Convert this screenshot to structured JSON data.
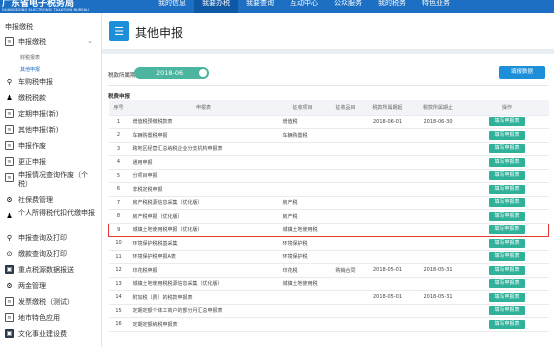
{
  "header": {
    "brand_zh": "广东省电子税务局",
    "brand_en": "GUANGDONG ELECTRONIC TAXATION BUREAU",
    "nav": [
      "我的信息",
      "我要办税",
      "我要查询",
      "互动中心",
      "公众服务",
      "我的税务",
      "特色业务"
    ]
  },
  "sidebar": {
    "title": "申报缴税",
    "items": [
      {
        "icon": "doc",
        "label": "申报缴税",
        "expanded": true
      },
      {
        "label": "财税报表"
      },
      {
        "label": "其他申报",
        "active": true
      },
      {
        "icon": "⚲",
        "label": "车购税申报"
      },
      {
        "icon": "♟",
        "label": "缴税税款"
      },
      {
        "icon": "doc",
        "label": "定期申报(新)"
      },
      {
        "icon": "doc",
        "label": "其他申报(新)"
      },
      {
        "icon": "doc",
        "label": "申报作废"
      },
      {
        "icon": "doc",
        "label": "更正申报"
      },
      {
        "icon": "doc",
        "label": "申报情况查询作废（个税）"
      },
      {
        "icon": "⚙",
        "label": "社保费管理"
      },
      {
        "icon": "♟",
        "label": "个人所得税代扣代缴申报"
      },
      {
        "icon": "⚲",
        "label": "申报查询及打印"
      },
      {
        "icon": "⊙",
        "label": "缴款查询及打印"
      },
      {
        "icon": "dark",
        "label": "重点税源数据报送"
      },
      {
        "icon": "⚙",
        "label": "两金管理"
      },
      {
        "icon": "doc",
        "label": "发票缴税（测试）"
      },
      {
        "icon": "doc",
        "label": "地市特色应用"
      },
      {
        "icon": "dark",
        "label": "文化事业建设费"
      }
    ]
  },
  "page": {
    "title": "其他申报",
    "period_label": "税款所属期：",
    "period_value": "2018-06",
    "help_button": "填报数据",
    "section_title": "税费申报"
  },
  "table": {
    "headers": [
      "序号",
      "申报表",
      "征收项目",
      "征收品目",
      "税款所属期起",
      "税款所属期止",
      "操作"
    ],
    "rows": [
      [
        "1",
        "增值税预缴税款表",
        "增值税",
        "",
        "2018-06-01",
        "2018-06-30",
        "填写申报表"
      ],
      [
        "2",
        "车辆购置税申报",
        "车辆购置税",
        "",
        "",
        "",
        "填写申报表"
      ],
      [
        "3",
        "跨地区经营汇总纳税企业分支机构申报表",
        "",
        "",
        "",
        "",
        "填写申报表"
      ],
      [
        "4",
        "通用申报",
        "",
        "",
        "",
        "",
        "填写申报表"
      ],
      [
        "5",
        "分项目申报",
        "",
        "",
        "",
        "",
        "填写申报表"
      ],
      [
        "6",
        "非税定税申报",
        "",
        "",
        "",
        "",
        "填写申报表"
      ],
      [
        "7",
        "房产税税源信息采集（优化版）",
        "房产税",
        "",
        "",
        "",
        "填写申报表"
      ],
      [
        "8",
        "房产税申报（优化版）",
        "房产税",
        "",
        "",
        "",
        "填写申报表"
      ],
      [
        "9",
        "城镇土地使用税申报（优化版）",
        "城镇土地使用税",
        "",
        "",
        "",
        "填写申报表"
      ],
      [
        "10",
        "环境保护税税基采集",
        "环境保护税",
        "",
        "",
        "",
        "填写申报表"
      ],
      [
        "11",
        "环境保护税申报A表",
        "环境保护税",
        "",
        "",
        "",
        "填写申报表"
      ],
      [
        "12",
        "印花税申报",
        "印花税",
        "购销合同",
        "2018-05-01",
        "2018-05-31",
        "填写申报表"
      ],
      [
        "13",
        "城镇土地使用税税源信息采集（优化版）",
        "城镇土地使用税",
        "",
        "",
        "",
        "填写申报表"
      ],
      [
        "14",
        "附加税（费）的税款申报表",
        "",
        "",
        "2018-05-01",
        "2018-05-31",
        "填写申报表"
      ],
      [
        "15",
        "定期定额个体工商户的部分月汇总申报表",
        "",
        "",
        "",
        "",
        "填写申报表"
      ],
      [
        "16",
        "定期定额纳税申报表",
        "",
        "",
        "",
        "",
        "填写申报表"
      ]
    ]
  },
  "colors": {
    "header_blue": "#1d6fc4",
    "op_green": "#2fb19a",
    "highlight_red": "#e53935"
  }
}
